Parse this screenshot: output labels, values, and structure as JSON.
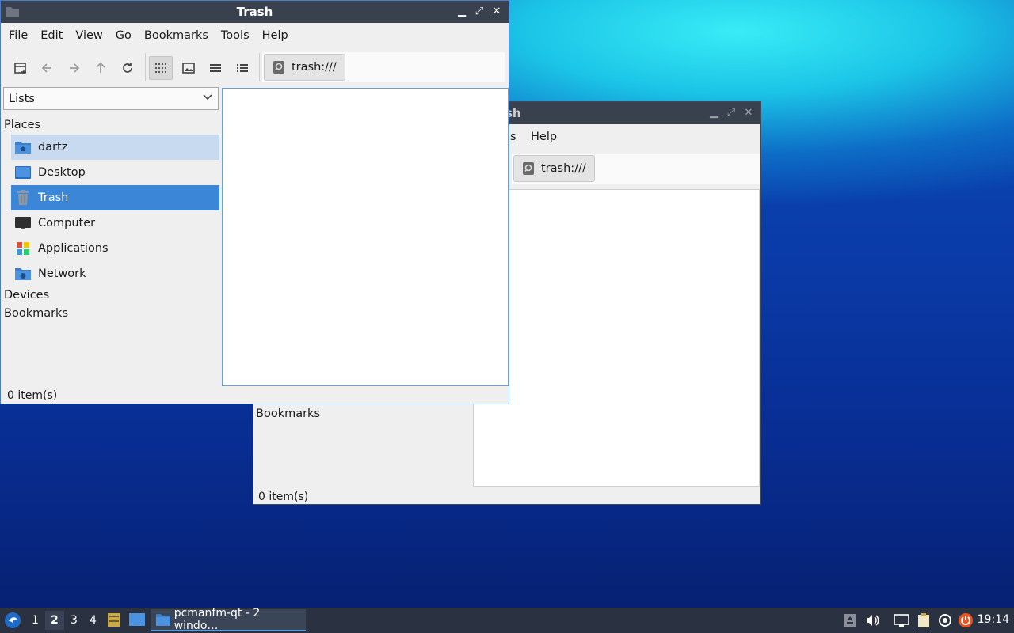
{
  "back_window": {
    "title_fragment": "sh",
    "menu_help": "Help",
    "menu_fragment": "s",
    "address": "trash:///",
    "side_section_bookmarks": "Bookmarks",
    "status": "0 item(s)"
  },
  "front_window": {
    "title": "Trash",
    "menu": [
      "File",
      "Edit",
      "View",
      "Go",
      "Bookmarks",
      "Tools",
      "Help"
    ],
    "address": "trash:///",
    "side_combo": "Lists",
    "sections": {
      "places": "Places",
      "devices": "Devices",
      "bookmarks": "Bookmarks"
    },
    "places": [
      {
        "label": "dartz",
        "icon": "home-folder-icon",
        "state": "hover"
      },
      {
        "label": "Desktop",
        "icon": "desktop-icon",
        "state": "normal"
      },
      {
        "label": "Trash",
        "icon": "trash-icon",
        "state": "selected"
      },
      {
        "label": "Computer",
        "icon": "computer-icon",
        "state": "normal"
      },
      {
        "label": "Applications",
        "icon": "applications-icon",
        "state": "normal"
      },
      {
        "label": "Network",
        "icon": "network-icon",
        "state": "normal"
      }
    ],
    "status": "0 item(s)"
  },
  "taskbar": {
    "workspaces": [
      "1",
      "2",
      "3",
      "4"
    ],
    "active_workspace": "2",
    "task_label": "pcmanfm-qt - 2 windo…",
    "clock": "19:14"
  },
  "colors": {
    "titlebar": "#39414f",
    "selection": "#3b86d6",
    "hover": "#c8daef",
    "taskbar": "#2a3140"
  }
}
